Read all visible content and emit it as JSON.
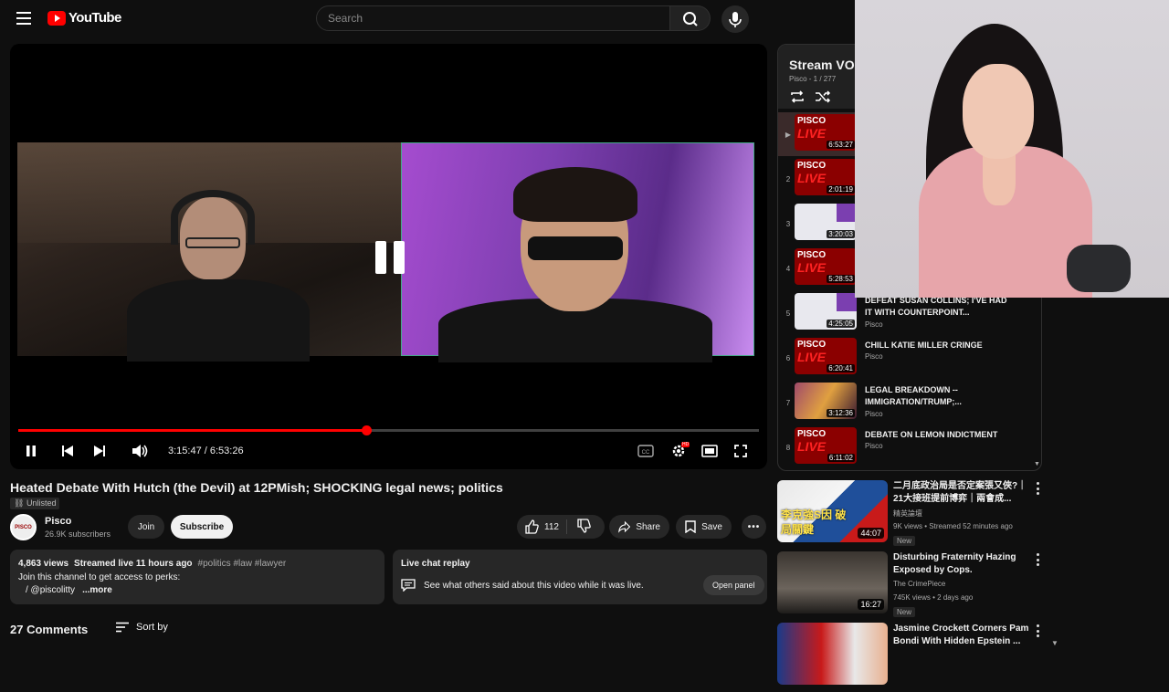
{
  "masthead": {
    "logo_text": "YouTube",
    "search_placeholder": "Search"
  },
  "player": {
    "current_time": "3:15:47",
    "separator": " / ",
    "duration": "6:53:26",
    "progress_fraction": 0.47,
    "state": "paused",
    "hd_badge": "HD"
  },
  "video": {
    "title": "Heated Debate With Hutch (the Devil) at 12PMish; SHOCKING legal news; politics",
    "privacy": "Unlisted",
    "channel_name": "Pisco",
    "channel_avatar_text": "PISCO",
    "subscribers": "26.9K subscribers",
    "join_label": "Join",
    "subscribe_label": "Subscribe",
    "likes": "112",
    "share_label": "Share",
    "save_label": "Save"
  },
  "description": {
    "views": "4,863 views",
    "streamed": "Streamed live 11 hours ago",
    "hashtags": "#politics #law #lawyer",
    "line1": "Join this channel to get access to perks:",
    "line2": "/ @piscolitty",
    "more": "...more"
  },
  "live_chat": {
    "title": "Live chat replay",
    "text": "See what others said about this video while it was live.",
    "button": "Open panel"
  },
  "comments": {
    "count_label": "27 Comments",
    "sort_label": "Sort by"
  },
  "playlist": {
    "title": "Stream VOD",
    "meta": "Pisco - 1 / 277",
    "items": [
      {
        "index": "▶",
        "thumb": "pisco",
        "duration": "6:53:27",
        "title": "",
        "channel": ""
      },
      {
        "index": "2",
        "thumb": "pisco",
        "duration": "2:01:19",
        "title": "",
        "channel": ""
      },
      {
        "index": "3",
        "thumb": "paper",
        "duration": "3:20:03",
        "title": "",
        "channel": ""
      },
      {
        "index": "4",
        "thumb": "pisco",
        "duration": "5:28:53",
        "title": "",
        "channel": ""
      },
      {
        "index": "5",
        "thumb": "paper",
        "duration": "4:25:05",
        "title": "DEFEAT SUSAN COLLINS; I'VE HAD IT WITH COUNTERPOINT...",
        "channel": "Pisco"
      },
      {
        "index": "6",
        "thumb": "pisco",
        "duration": "6:20:41",
        "title": "CHILL KATIE MILLER CRINGE",
        "channel": "Pisco"
      },
      {
        "index": "7",
        "thumb": "mixed",
        "duration": "3:12:36",
        "title": "LEGAL BREAKDOWN -- IMMIGRATION/TRUMP;...",
        "channel": "Pisco"
      },
      {
        "index": "8",
        "thumb": "pisco",
        "duration": "6:11:02",
        "title": "DEBATE ON LEMON INDICTMENT",
        "channel": "Pisco"
      }
    ],
    "thumb_label": "PISCO",
    "thumb_live": "LIVE"
  },
  "recommendations": [
    {
      "title": "二月底政治局是否定案張又俠?｜21大接班提前博弈｜兩會成...",
      "channel": "精英論壇",
      "meta": "9K views • Streamed 52 minutes ago",
      "badge": "New",
      "duration": "44:07",
      "thumb_text": "李克強S因 破局關鍵"
    },
    {
      "title": "Disturbing Fraternity Hazing Exposed by Cops.",
      "channel": "The CrimePiece",
      "meta": "745K views • 2 days ago",
      "badge": "New",
      "duration": "16:27",
      "thumb_text": ""
    },
    {
      "title": "Jasmine Crockett Corners Pam Bondi With Hidden Epstein ...",
      "channel": "",
      "meta": "",
      "badge": "",
      "duration": "",
      "thumb_text": ""
    }
  ],
  "colors": {
    "accent": "#ff0000",
    "background": "#0f0f0f",
    "surface": "#272727"
  }
}
